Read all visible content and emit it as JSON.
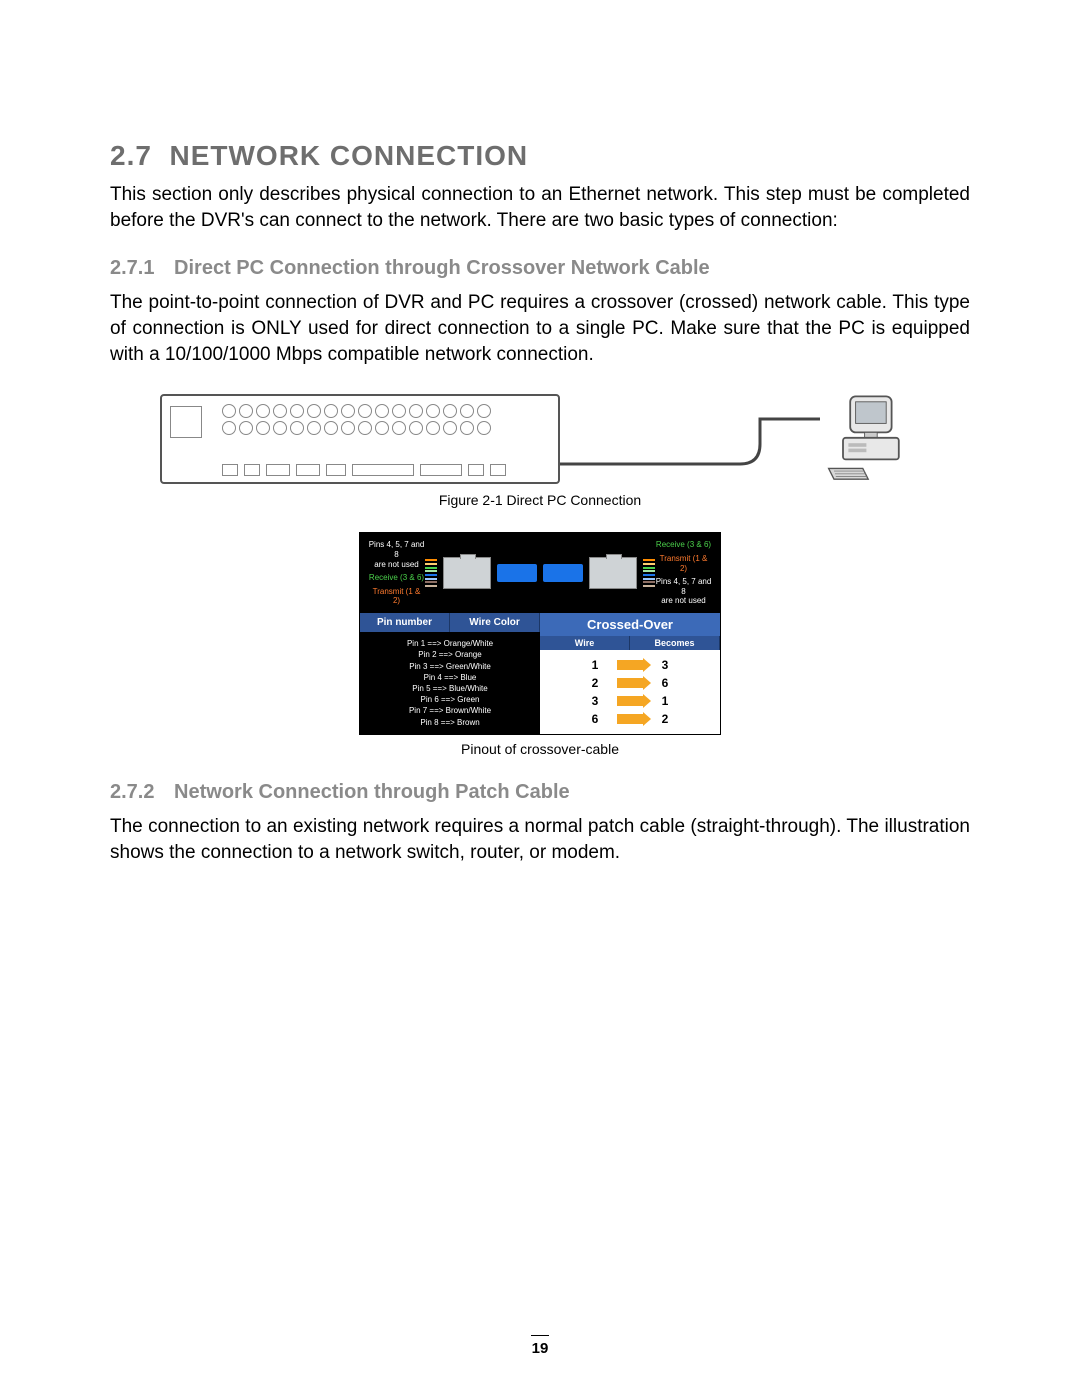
{
  "section": {
    "number": "2.7",
    "title": "NETWORK CONNECTION",
    "intro": "This section only describes physical connection to an Ethernet network. This step must be completed before the DVR's can connect to the network. There are two basic types of connection:"
  },
  "sub1": {
    "number": "2.7.1",
    "title": "Direct PC Connection through Crossover Network Cable",
    "body": "The point-to-point connection of DVR and PC requires a crossover (crossed) network cable. This type of connection is ONLY used for direct connection to a single PC. Make sure that the PC is equipped with a 10/100/1000 Mbps compatible network connection."
  },
  "figure1_caption": "Figure 2-1 Direct PC Connection",
  "pinout": {
    "top_left": {
      "notused": "Pins 4, 5, 7 and 8\nare not used",
      "rx": "Receive (3 & 6)",
      "tx": "Transmit (1 & 2)"
    },
    "top_right": {
      "rx": "Receive (3 & 6)",
      "tx": "Transmit (1 & 2)",
      "notused": "Pins 4, 5, 7 and 8\nare not used"
    },
    "left_header_pin": "Pin number",
    "left_header_color": "Wire Color",
    "right_header_top": "Crossed-Over",
    "right_header_wire": "Wire",
    "right_header_becomes": "Becomes",
    "pins": [
      "Pin 1 ==> Orange/White",
      "Pin 2 ==> Orange",
      "Pin 3 ==> Green/White",
      "Pin 4 ==> Blue",
      "Pin 5 ==> Blue/White",
      "Pin 6 ==> Green",
      "Pin 7 ==> Brown/White",
      "Pin 8 ==> Brown"
    ],
    "cross": [
      {
        "a": "1",
        "b": "3"
      },
      {
        "a": "2",
        "b": "6"
      },
      {
        "a": "3",
        "b": "1"
      },
      {
        "a": "6",
        "b": "2"
      }
    ],
    "caption": "Pinout of crossover-cable"
  },
  "sub2": {
    "number": "2.7.2",
    "title": "Network Connection through Patch Cable",
    "body": "The connection to an existing network requires a normal patch cable (straight-through). The illustration shows the connection to a network switch, router, or modem."
  },
  "page_number": "19"
}
